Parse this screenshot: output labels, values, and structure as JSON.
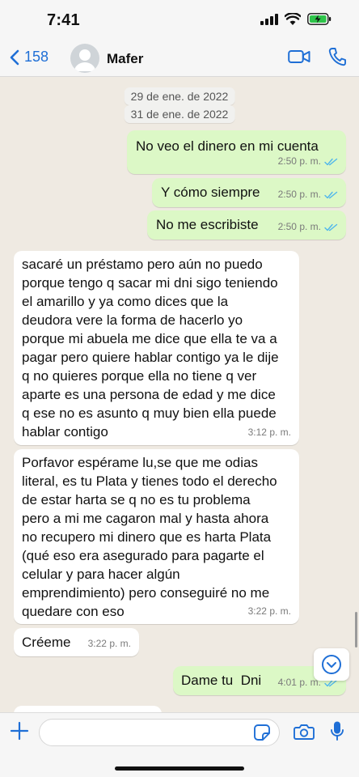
{
  "status_bar": {
    "time": "7:41",
    "icons": [
      "signal-icon",
      "wifi-icon",
      "battery-charging-icon"
    ]
  },
  "header": {
    "back_count": "158",
    "contact_name": "Mafer",
    "actions": [
      "video-call-icon",
      "phone-icon"
    ]
  },
  "dates": [
    "29 de ene. de 2022",
    "31 de ene. de 2022"
  ],
  "messages": [
    {
      "dir": "out",
      "text": "No veo el dinero en mi cuenta",
      "time": "2:50 p. m.",
      "read": true
    },
    {
      "dir": "out",
      "text": "Y cómo siempre",
      "time": "2:50 p. m.",
      "read": true
    },
    {
      "dir": "out",
      "text": "No me escribiste",
      "time": "2:50 p. m.",
      "read": true
    },
    {
      "dir": "in",
      "lines": [
        "sacaré un préstamo pero aún no puedo",
        "porque tengo q sacar mi dni sigo teniendo",
        "el amarillo y ya como dices que la",
        "deudora vere la forma de hacerlo yo",
        "porque mi abuela me dice que ella te va a",
        "pagar pero quiere hablar contigo ya le dije",
        "q no quieres porque ella no tiene q ver",
        "aparte es una persona de edad y me dice",
        "q ese no es asunto q muy bien ella puede",
        "hablar contigo"
      ],
      "time": "3:12 p. m."
    },
    {
      "dir": "in",
      "lines": [
        "Porfavor espérame lu,se que me odias",
        "literal, es tu Plata y tienes todo el derecho",
        "de estar harta se q no es tu problema",
        "pero a mi me cagaron mal y hasta ahora",
        "no recupero mi dinero que es harta Plata",
        "(qué eso era asegurado para pagarte el",
        "celular y para hacer algún",
        "emprendimiento) pero conseguiré no me",
        "quedare con eso"
      ],
      "time": "3:22 p. m."
    },
    {
      "dir": "in",
      "text": "Créeme",
      "time": "3:22 p. m."
    },
    {
      "dir": "out",
      "text": "Dame tu  Dni",
      "time": "4:01 p. m.",
      "read": true
    }
  ],
  "colors": {
    "outgoing": "#dcf8c6",
    "incoming": "#ffffff",
    "accent": "#1f6fd6",
    "read_ticks": "#4fb6ec",
    "background": "#efeae2"
  }
}
